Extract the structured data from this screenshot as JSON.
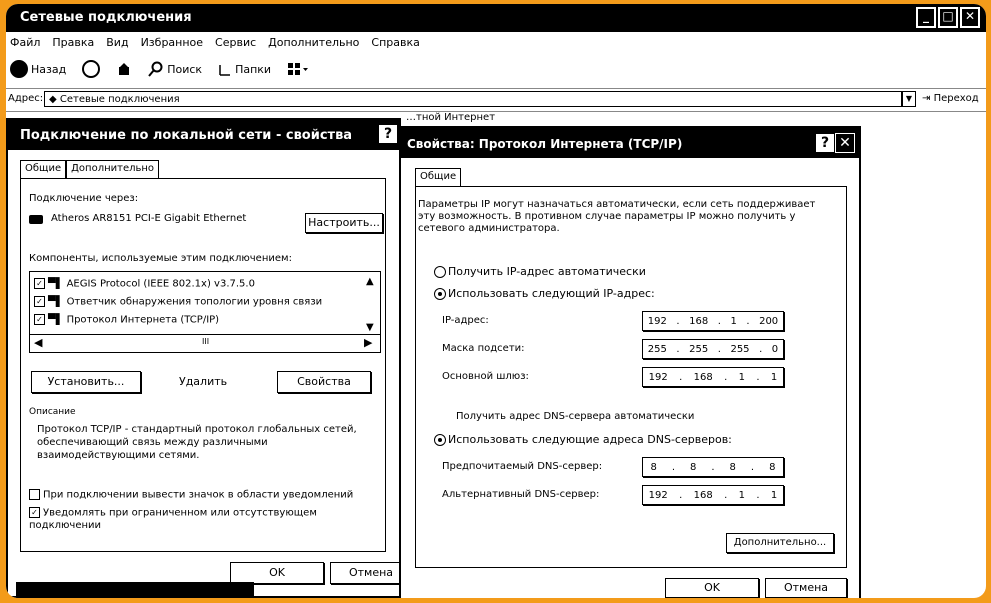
{
  "window": {
    "title": "Сетевые подключения",
    "menu": [
      "Файл",
      "Правка",
      "Вид",
      "Избранное",
      "Сервис",
      "Дополнительно",
      "Справка"
    ],
    "toolbar": {
      "back": "Назад",
      "search": "Поиск",
      "folders": "Папки"
    },
    "address": {
      "label": "Адрес:",
      "value": "Сетевые подключения",
      "go": "Переход"
    },
    "behind_text": "…тной Интернет"
  },
  "dialog1": {
    "title": "Подключение по локальной сети - свойства",
    "tabs": [
      "Общие",
      "Дополнительно"
    ],
    "connect_via_label": "Подключение через:",
    "adapter": "Atheros AR8151 PCI-E Gigabit Ethernet",
    "configure_button": "Настроить...",
    "components_label": "Компоненты, используемые этим подключением:",
    "components": [
      "AEGIS Protocol (IEEE 802.1x) v3.7.5.0",
      "Ответчик обнаружения топологии уровня связи",
      "Протокол Интернета (TCP/IP)"
    ],
    "scroll_mid": "III",
    "install_button": "Установить...",
    "remove_button": "Удалить",
    "properties_button": "Свойства",
    "description_label": "Описание",
    "description": "Протокол TCP/IP - стандартный протокол глобальных сетей, обеспечивающий связь между различными взаимодействующими сетями.",
    "show_icon_label": "При подключении вывести значок в области уведомлений",
    "notify_label": "Уведомлять при ограниченном или отсутствующем подключении",
    "ok_button": "OK",
    "cancel_button": "Отмена"
  },
  "dialog2": {
    "title": "Свойства: Протокол Интернета (TCP/IP)",
    "tab": "Общие",
    "intro": "Параметры IP могут назначаться автоматически, если сеть поддерживает эту возможность. В противном случае параметры IP можно получить у сетевого администратора.",
    "auto_ip_label": "Получить IP-адрес автоматически",
    "manual_ip_label": "Использовать следующий IP-адрес:",
    "ip_label": "IP-адрес:",
    "ip": [
      "192",
      "168",
      "1",
      "200"
    ],
    "mask_label": "Маска подсети:",
    "mask": [
      "255",
      "255",
      "255",
      "0"
    ],
    "gateway_label": "Основной шлюз:",
    "gateway": [
      "192",
      "168",
      "1",
      "1"
    ],
    "auto_dns_label": "Получить адрес DNS-сервера автоматически",
    "manual_dns_label": "Использовать следующие адреса DNS-серверов:",
    "pref_dns_label": "Предпочитаемый DNS-сервер:",
    "pref_dns": [
      "8",
      "8",
      "8",
      "8"
    ],
    "alt_dns_label": "Альтернативный DNS-сервер:",
    "alt_dns": [
      "192",
      "168",
      "1",
      "1"
    ],
    "advanced_button": "Дополнительно...",
    "ok_button": "OK",
    "cancel_button": "Отмена"
  },
  "colors": {
    "border": "#f39b1a",
    "title_bg": "#000000"
  }
}
